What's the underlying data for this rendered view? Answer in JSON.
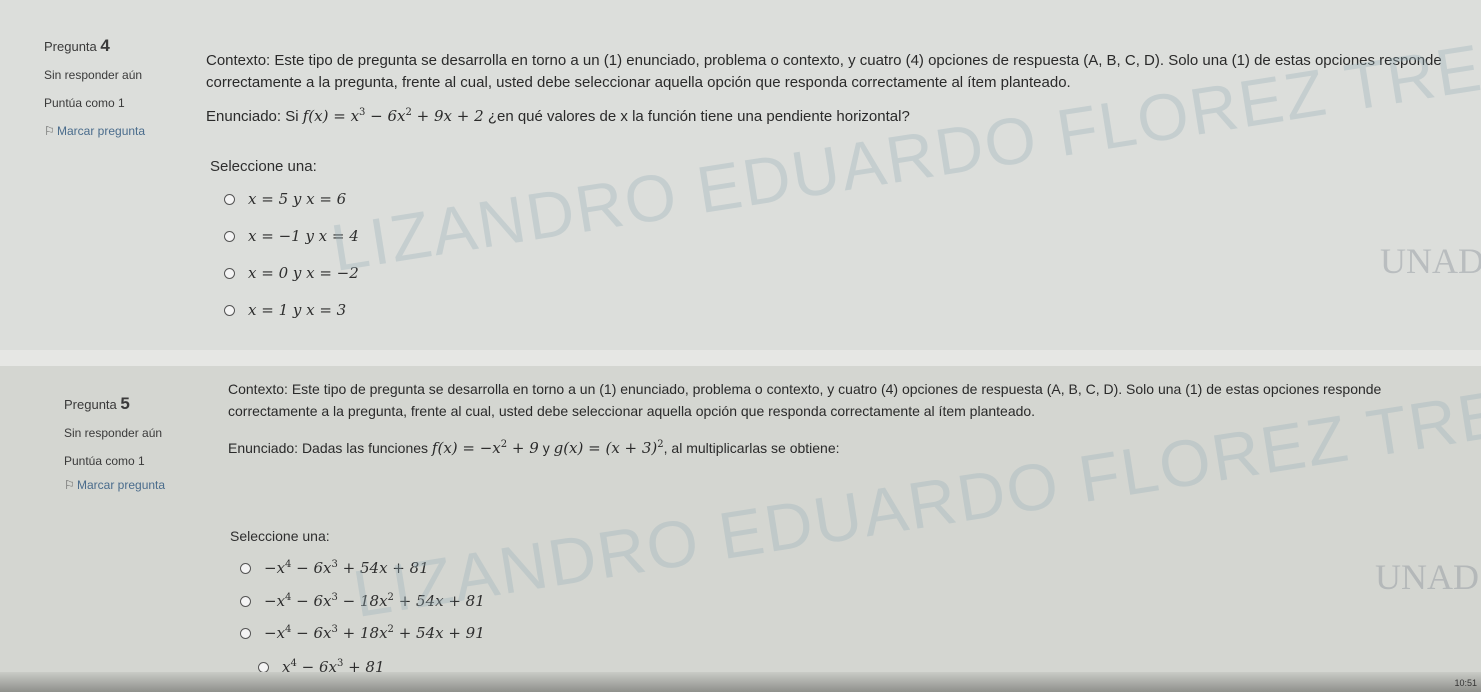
{
  "q1": {
    "label": "Pregunta",
    "number": "4",
    "status": "Sin responder aún",
    "score": "Puntúa como 1",
    "flag": "Marcar pregunta",
    "context_line1": "Contexto: Este tipo de pregunta se desarrolla en torno a un (1) enunciado, problema o contexto, y cuatro (4) opciones de respuesta (A, B, C, D). Solo una (1) de estas opciones responde",
    "context_line2": "correctamente a la pregunta, frente al cual, usted debe seleccionar aquella opción que responda correctamente al ítem planteado.",
    "statement_pre": "Enunciado: Si",
    "statement_post": "¿en qué valores de x la función tiene una pendiente horizontal?",
    "select_label": "Seleccione una:",
    "options": [
      "x = 5 y x = 6",
      "x = −1 y x = 4",
      "x = 0 y x = −2",
      "x = 1 y x = 3"
    ]
  },
  "q2": {
    "label": "Pregunta",
    "number": "5",
    "status": "Sin responder aún",
    "score": "Puntúa como 1",
    "flag": "Marcar pregunta",
    "context_line1": "Contexto: Este tipo de pregunta se desarrolla en torno a un (1) enunciado, problema o contexto, y cuatro (4) opciones de respuesta (A, B, C, D). Solo una (1) de estas opciones responde",
    "context_line2": "correctamente a la pregunta, frente al cual, usted debe seleccionar aquella opción que responda correctamente al ítem planteado.",
    "statement_pre": "Enunciado: Dadas las funciones",
    "statement_mid": "y",
    "statement_post": ", al multiplicarlas se obtiene:",
    "select_label": "Seleccione una:"
  },
  "watermark": {
    "line": "LIZANDRO EDUARDO FLOREZ TREJOS"
  },
  "logo": "UNAD",
  "clock": "10:51"
}
